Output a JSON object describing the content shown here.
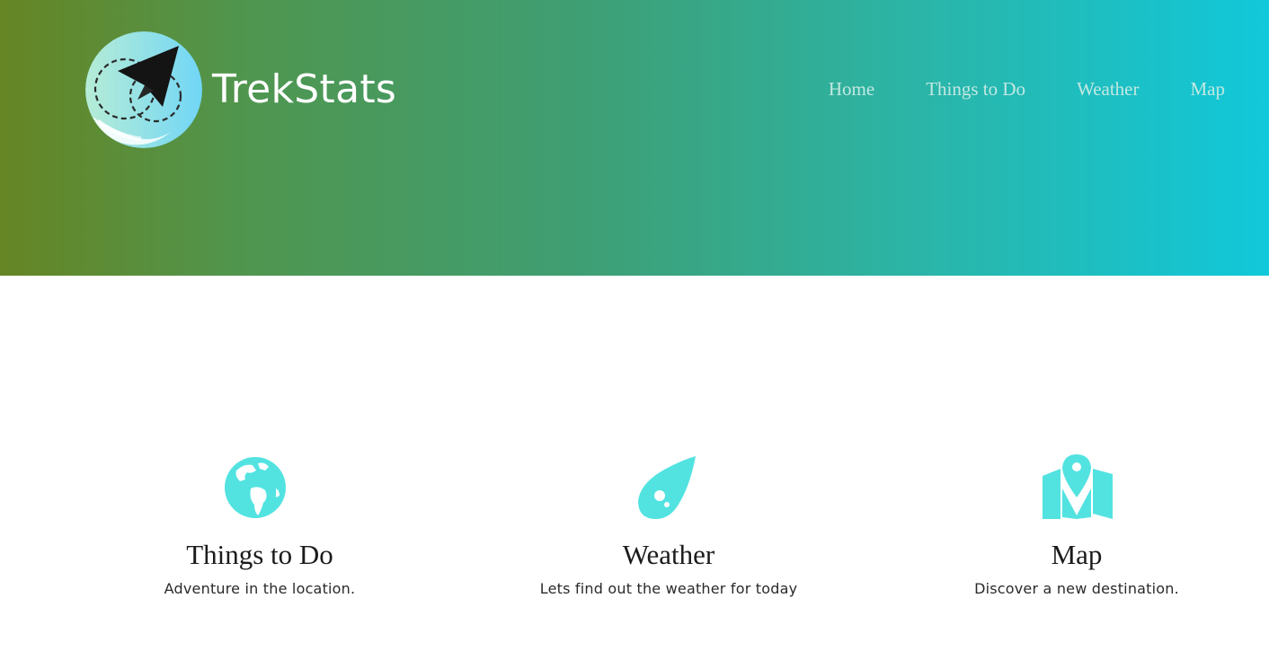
{
  "brand": {
    "name": "TrekStats",
    "logo_icon": "paper-plane-logo-icon"
  },
  "nav": {
    "items": [
      {
        "label": "Home"
      },
      {
        "label": "Things to Do"
      },
      {
        "label": "Weather"
      },
      {
        "label": "Map"
      }
    ]
  },
  "features": [
    {
      "icon": "globe-icon",
      "title": "Things to Do",
      "description": "Adventure in the location."
    },
    {
      "icon": "meteor-icon",
      "title": "Weather",
      "description": "Lets find out the weather for today"
    },
    {
      "icon": "map-marker-icon",
      "title": "Map",
      "description": "Discover a new destination."
    }
  ],
  "colors": {
    "hero_gradient_start": "#668524",
    "hero_gradient_end": "#11c8da",
    "icon_accent": "#52e3e1",
    "nav_text": "#c3e8e2",
    "brand_text": "#ffffff"
  }
}
